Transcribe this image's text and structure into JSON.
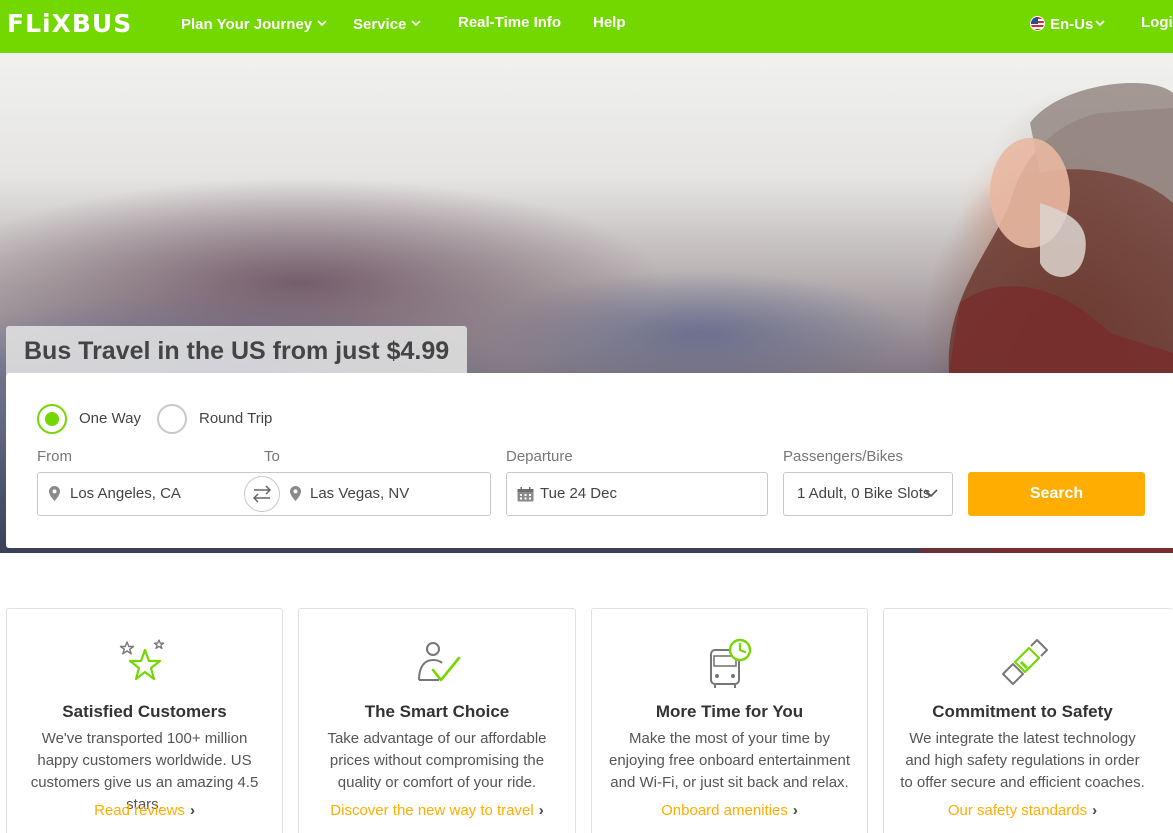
{
  "nav": {
    "logo": "FLiXBUS",
    "items": [
      {
        "label": "Plan Your Journey",
        "chevron": true
      },
      {
        "label": "Service",
        "chevron": true
      },
      {
        "label": "Real-Time Info",
        "chevron": false
      },
      {
        "label": "Help",
        "chevron": false
      }
    ],
    "language": "En-Us",
    "login": "Login"
  },
  "hero": {
    "title": "Bus Travel in the US from just $4.99"
  },
  "search": {
    "trip_types": [
      {
        "label": "One Way",
        "selected": true
      },
      {
        "label": "Round Trip",
        "selected": false
      }
    ],
    "from_label": "From",
    "from_value": "Los Angeles, CA",
    "to_label": "To",
    "to_value": "Las Vegas, NV",
    "departure_label": "Departure",
    "departure_value": "Tue 24 Dec",
    "passengers_label": "Passengers/Bikes",
    "passengers_value": "1 Adult, 0 Bike Slots",
    "button": "Search"
  },
  "cards": [
    {
      "icon": "stars-icon",
      "title": "Satisfied Customers",
      "text": "We've transported 100+ million happy customers worldwide. US customers give us an amazing 4.5 stars.",
      "link": "Read reviews"
    },
    {
      "icon": "person-check-icon",
      "title": "The Smart Choice",
      "text": "Take advantage of our affordable prices without compromising the quality or comfort of your ride.",
      "link": "Discover the new way to travel"
    },
    {
      "icon": "bus-clock-icon",
      "title": "More Time for You",
      "text": "Make the most of your time by enjoying free onboard entertainment and Wi-Fi, or just sit back and relax.",
      "link": "Onboard amenities"
    },
    {
      "icon": "seatbelt-icon",
      "title": "Commitment to Safety",
      "text": "We integrate the latest technology and high safety regulations in order to offer secure and efficient coaches.",
      "link": "Our safety standards"
    }
  ],
  "colors": {
    "brand_green": "#73d700",
    "accent_orange": "#ffad00"
  }
}
